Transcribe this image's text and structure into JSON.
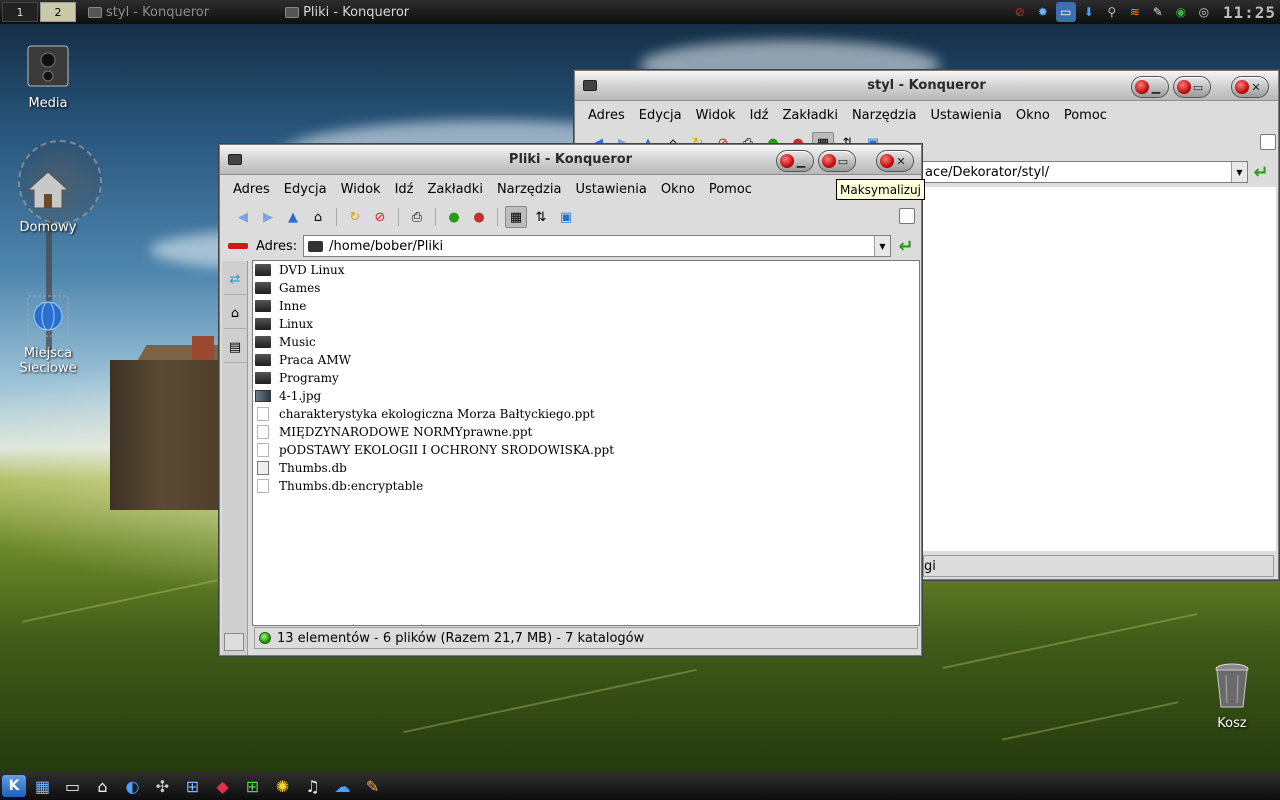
{
  "desktop": {
    "icons": [
      {
        "label": "Media"
      },
      {
        "label": "Domowy"
      },
      {
        "label": "Miejsca Sieciowe"
      },
      {
        "label": "Kosz"
      }
    ]
  },
  "top_panel": {
    "desktops": [
      "1",
      "2"
    ],
    "tasks": [
      {
        "label": "styl - Konqueror"
      },
      {
        "label": "Pliki - Konqueror"
      }
    ],
    "clock": "11:25"
  },
  "back_window": {
    "title": "styl - Konqueror",
    "menu": [
      "Adres",
      "Edycja",
      "Widok",
      "Idź",
      "Zakładki",
      "Narzędzia",
      "Ustawienia",
      "Okno",
      "Pomoc"
    ],
    "address_partial": "ace/Dekorator/styl/",
    "status_partial": "gi"
  },
  "front_window": {
    "title": "Pliki - Konqueror",
    "menu": [
      "Adres",
      "Edycja",
      "Widok",
      "Idź",
      "Zakładki",
      "Narzędzia",
      "Ustawienia",
      "Okno",
      "Pomoc"
    ],
    "address_label": "Adres:",
    "address_value": "/home/bober/Pliki",
    "files": [
      {
        "name": "DVD Linux",
        "kind": "folder"
      },
      {
        "name": "Games",
        "kind": "folder"
      },
      {
        "name": "Inne",
        "kind": "folder"
      },
      {
        "name": "Linux",
        "kind": "folder"
      },
      {
        "name": "Music",
        "kind": "folder"
      },
      {
        "name": "Praca AMW",
        "kind": "folder"
      },
      {
        "name": "Programy",
        "kind": "folder"
      },
      {
        "name": "4-1.jpg",
        "kind": "image"
      },
      {
        "name": "charakterystyka ekologiczna Morza Bałtyckiego.ppt",
        "kind": "doc"
      },
      {
        "name": "MIĘDZYNARODOWE NORMYprawne.ppt",
        "kind": "doc"
      },
      {
        "name": "pODSTAWY EKOLOGII I OCHRONY SRODOWISKA.ppt",
        "kind": "doc"
      },
      {
        "name": "Thumbs.db",
        "kind": "db"
      },
      {
        "name": "Thumbs.db:encryptable",
        "kind": "doc"
      }
    ],
    "status": "13 elementów - 6 plików (Razem 21,7 MB) - 7 katalogów"
  },
  "tooltip": "Maksymalizuj"
}
